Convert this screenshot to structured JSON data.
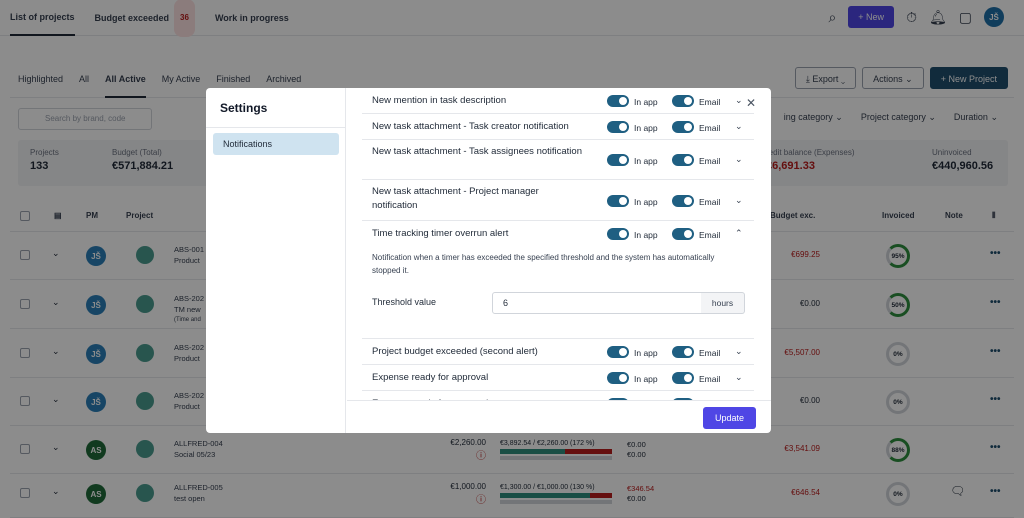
{
  "topbar": {
    "tabs": [
      {
        "label": "List of projects"
      },
      {
        "label": "Budget exceeded",
        "badge": "36"
      },
      {
        "label": "Work in progress"
      }
    ],
    "new_label": "+ New",
    "notif_badge": "1",
    "avatar": "JŠ"
  },
  "subtabs": [
    "Highlighted",
    "All",
    "All Active",
    "My Active",
    "Finished",
    "Archived"
  ],
  "actions": {
    "export": "Export",
    "actions": "Actions",
    "new_project": "+ New Project"
  },
  "filters": {
    "search_placeholder": "Search by brand, code",
    "items": [
      "ing category",
      "Project category",
      "Duration"
    ]
  },
  "stats": [
    {
      "label": "Projects",
      "value": "133"
    },
    {
      "label": "Budget (Total)",
      "value": "€571,884.21"
    },
    {
      "label": "redit balance (Expenses)",
      "value": "€6,691.33"
    },
    {
      "label": "Uninvoiced",
      "value": "€440,960.56"
    }
  ],
  "table": {
    "headers": {
      "pm": "PM",
      "project": "Project",
      "budget_exc": "Budget exc.",
      "invoiced": "Invoiced",
      "note": "Note"
    },
    "rows": [
      {
        "pm": "JŠ",
        "pm_color": "#2a7fb8",
        "code": "ABS-001",
        "name": "Product",
        "extra": "",
        "budget": "",
        "bar": "",
        "credit": "",
        "credit2": "",
        "exc": "€699.25",
        "exc_red": true,
        "ring": "95%",
        "ring_fill": 0.95
      },
      {
        "pm": "JŠ",
        "pm_color": "#2a7fb8",
        "code": "ABS-202",
        "name": "TM new",
        "extra": "(Time and",
        "budget": "",
        "bar": "",
        "credit": "",
        "credit2": "",
        "exc": "€0.00",
        "exc_red": false,
        "ring": "50%",
        "ring_fill": 0.5
      },
      {
        "pm": "JŠ",
        "pm_color": "#2a7fb8",
        "code": "ABS-202",
        "name": "Product",
        "extra": "",
        "budget": "",
        "bar": "",
        "credit": "",
        "credit2": "",
        "exc": "€5,507.00",
        "exc_red": true,
        "ring": "0%",
        "ring_fill": 0
      },
      {
        "pm": "JŠ",
        "pm_color": "#2a7fb8",
        "code": "ABS-202",
        "name": "Product",
        "extra": "",
        "budget": "",
        "bar": "",
        "credit": "",
        "credit2": "",
        "exc": "€0.00",
        "exc_red": false,
        "ring": "0%",
        "ring_fill": 0
      },
      {
        "pm": "AS",
        "pm_color": "#1f6b3a",
        "code": "ALLFRED-004",
        "name": "Social 05/23",
        "extra": "",
        "budget": "€2,260.00",
        "bar": "€3,892.54 / €2,260.00 (172 %)",
        "credit": "€0.00",
        "credit2": "€0.00",
        "exc": "€3,541.09",
        "exc_red": true,
        "ring": "88%",
        "ring_fill": 0.88
      },
      {
        "pm": "AS",
        "pm_color": "#1f6b3a",
        "code": "ALLFRED-005",
        "name": "test open",
        "extra": "",
        "budget": "€1,000.00",
        "bar": "€1,300.00 / €1,000.00 (130 %)",
        "credit": "€346.54",
        "credit2": "€0.00",
        "exc": "€646.54",
        "exc_red": true,
        "ring": "0%",
        "ring_fill": 0
      }
    ]
  },
  "modal": {
    "title": "Settings",
    "nav": "Notifications",
    "in_app": "In app",
    "email": "Email",
    "items": [
      "New mention in task description",
      "New task attachment - Task creator notification",
      "New task attachment - Task assignees notification",
      "New task attachment - Project manager notification",
      "Time tracking timer overrun alert",
      "Project budget exceeded (second alert)",
      "Expense ready for approval",
      "Expense ready for approval"
    ],
    "description": "Notification when a timer has exceeded the specified threshold and the system has automatically stopped it.",
    "threshold_label": "Threshold value",
    "threshold_value": "6",
    "threshold_unit": "hours",
    "update": "Update"
  }
}
